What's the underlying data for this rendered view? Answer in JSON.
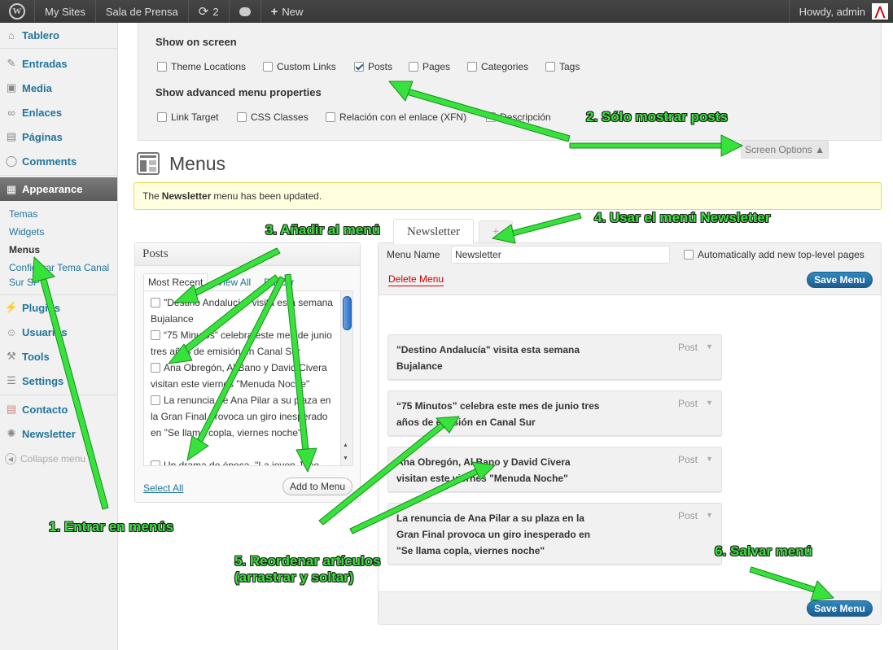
{
  "adminbar": {
    "my_sites": "My Sites",
    "site_name": "Sala de Prensa",
    "updates_count": "2",
    "new_label": "New",
    "howdy": "Howdy, admin"
  },
  "sidebar": {
    "items": [
      {
        "label": "Tablero",
        "icon": "dashboard-icon"
      },
      {
        "label": "Entradas",
        "icon": "pin-icon"
      },
      {
        "label": "Media",
        "icon": "media-icon"
      },
      {
        "label": "Enlaces",
        "icon": "link-icon"
      },
      {
        "label": "Páginas",
        "icon": "page-icon"
      },
      {
        "label": "Comments",
        "icon": "comment-icon"
      },
      {
        "label": "Appearance",
        "icon": "appearance-icon"
      },
      {
        "label": "Plugins",
        "icon": "plugin-icon"
      },
      {
        "label": "Usuarios",
        "icon": "users-icon"
      },
      {
        "label": "Tools",
        "icon": "tools-icon"
      },
      {
        "label": "Settings",
        "icon": "settings-icon"
      },
      {
        "label": "Contacto",
        "icon": "contact-icon"
      },
      {
        "label": "Newsletter",
        "icon": "newsletter-icon"
      },
      {
        "label": "Collapse menu",
        "icon": "collapse-icon"
      }
    ],
    "submenu": [
      "Temas",
      "Widgets",
      "Menus",
      "Configurar Tema Canal",
      "Sur SP"
    ]
  },
  "screen_options": {
    "heading1": "Show on screen",
    "boxes1": [
      {
        "label": "Theme Locations",
        "checked": false
      },
      {
        "label": "Custom Links",
        "checked": false
      },
      {
        "label": "Posts",
        "checked": true
      },
      {
        "label": "Pages",
        "checked": false
      },
      {
        "label": "Categories",
        "checked": false
      },
      {
        "label": "Tags",
        "checked": false
      }
    ],
    "heading2": "Show advanced menu properties",
    "boxes2": [
      {
        "label": "Link Target",
        "checked": false
      },
      {
        "label": "CSS Classes",
        "checked": false
      },
      {
        "label": "Relación con el enlace (XFN)",
        "checked": false
      },
      {
        "label": "Descripción",
        "checked": false
      }
    ],
    "tab_label": "Screen Options ▲"
  },
  "page": {
    "title": "Menus",
    "notice_pre": "The",
    "notice_bold": "Newsletter",
    "notice_post": "menu has been updated."
  },
  "posts_box": {
    "title": "Posts",
    "tabs": [
      "Most Recent",
      "View All",
      "Buscar"
    ],
    "items": [
      "\"Destino Andalucía\" visita esta semana Bujalance",
      "“75 Minutos” celebra este mes de junio tres años de emisión en Canal Sur",
      "Ana Obregón, Al Bano y David Civera visitan este viernes \"Menuda Noche\"",
      "La renuncia de Ana Pilar a su plaza en la Gran Final provoca un giro inesperado en \"Se llama copla, viernes noche\"",
      "Un drama de época, \"La joven Jane"
    ],
    "select_all": "Select All",
    "add_button": "Add to Menu"
  },
  "menu_tabs": [
    "Newsletter",
    "+"
  ],
  "menu_edit": {
    "name_label": "Menu Name",
    "name_value": "Newsletter",
    "auto_add": "Automatically add new top-level pages",
    "delete": "Delete Menu",
    "save": "Save Menu",
    "items": [
      {
        "title": "\"Destino Andalucía\" visita esta semana Bujalance",
        "type": "Post"
      },
      {
        "title": "“75 Minutos” celebra este mes de junio tres años de emisión en Canal Sur",
        "type": "Post"
      },
      {
        "title": "Ana Obregón, Al Bano y David Civera visitan este viernes \"Menuda Noche\"",
        "type": "Post"
      },
      {
        "title": "La renuncia de Ana Pilar a su plaza en la Gran Final provoca un giro inesperado en \"Se llama copla, viernes noche\"",
        "type": "Post"
      }
    ]
  },
  "annotations": [
    "1. Entrar en menús",
    "2. Sólo mostrar posts",
    "3. Añadir al menú",
    "4. Usar el menú Newsletter",
    "5. Reordenar artículos",
    "(arrastrar y soltar)",
    "6. Salvar menú"
  ],
  "colors": {
    "annotation": "#38e23c",
    "link": "#21759b",
    "save_button": "#2178b0",
    "notice_bg": "#ffffe0"
  }
}
